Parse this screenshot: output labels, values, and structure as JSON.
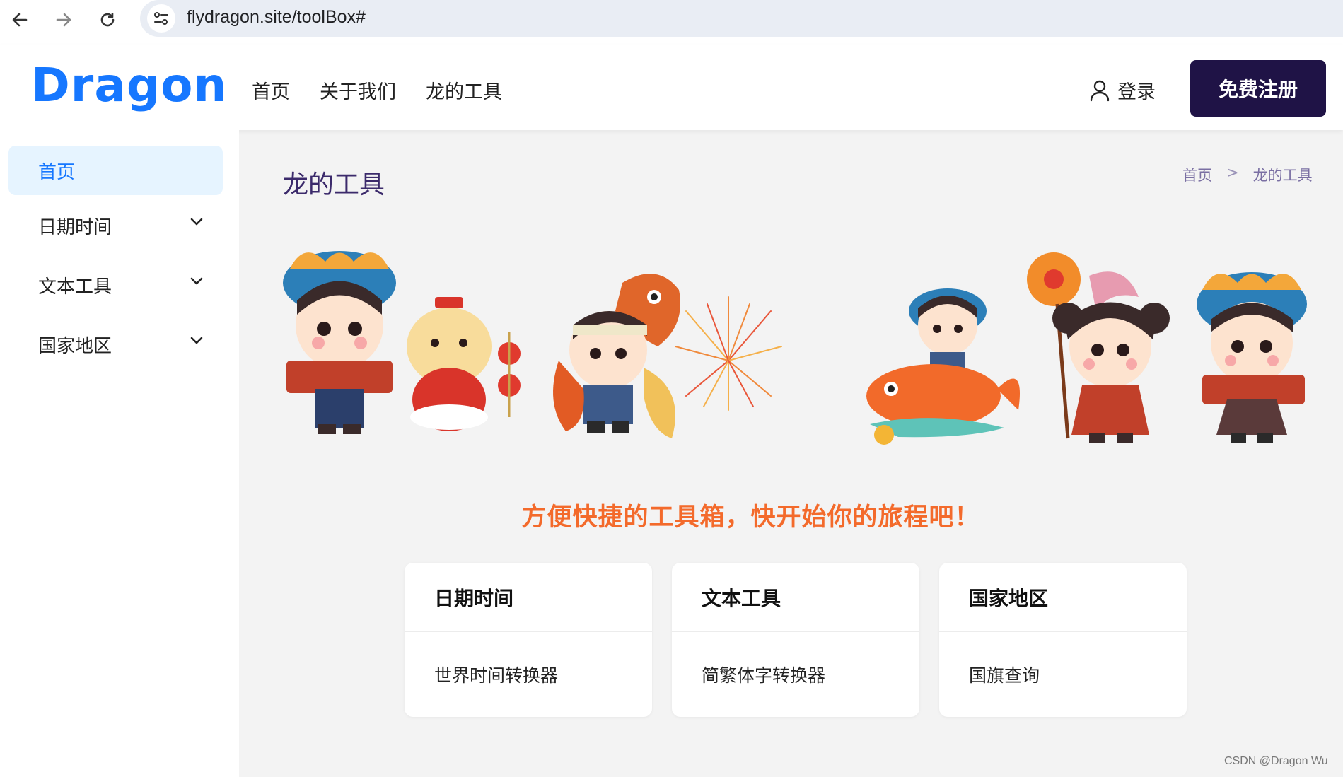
{
  "browser": {
    "url": "flydragon.site/toolBox#"
  },
  "header": {
    "logo": "Dragon",
    "nav": [
      "首页",
      "关于我们",
      "龙的工具"
    ],
    "login_label": "登录",
    "register_label": "免费注册"
  },
  "sidebar": {
    "items": [
      {
        "label": "首页",
        "active": true
      },
      {
        "label": "日期时间",
        "expandable": true
      },
      {
        "label": "文本工具",
        "expandable": true
      },
      {
        "label": "国家地区",
        "expandable": true
      }
    ]
  },
  "main": {
    "title": "龙的工具",
    "breadcrumb": [
      "首页",
      ">",
      "龙的工具"
    ],
    "slogan": "方便快捷的工具箱，快开始你的旅程吧！",
    "cards": [
      {
        "title": "日期时间",
        "link": "世界时间转换器"
      },
      {
        "title": "文本工具",
        "link": "简繁体字转换器"
      },
      {
        "title": "国家地区",
        "link": "国旗查询"
      }
    ]
  },
  "watermark": "CSDN @Dragon   Wu",
  "colors": {
    "brand": "#1677ff",
    "register_bg": "#1f1346",
    "slogan": "#f36a2b",
    "title": "#3b2a6b",
    "active_bg": "#e6f4ff"
  },
  "icons": [
    "back-arrow-icon",
    "forward-arrow-icon",
    "reload-icon",
    "site-settings-icon",
    "user-icon",
    "chevron-down-icon"
  ]
}
